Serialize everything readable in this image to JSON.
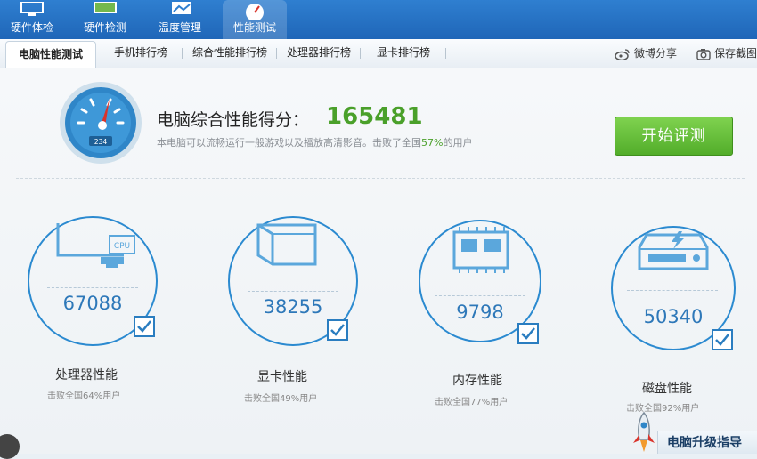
{
  "top_nav": {
    "items": [
      {
        "label": "硬件体检",
        "icon": "monitor-icon",
        "active": false
      },
      {
        "label": "硬件检测",
        "icon": "monitor-icon",
        "active": false
      },
      {
        "label": "温度管理",
        "icon": "chart-icon",
        "active": false
      },
      {
        "label": "性能测试",
        "icon": "speedometer-icon",
        "active": true
      }
    ]
  },
  "sub_tabs": {
    "items": [
      {
        "label": "电脑性能测试",
        "active": true
      },
      {
        "label": "手机排行榜",
        "active": false
      },
      {
        "label": "综合性能排行榜",
        "active": false
      },
      {
        "label": "处理器排行榜",
        "active": false
      },
      {
        "label": "显卡排行榜",
        "active": false
      }
    ],
    "weibo_share": "微博分享",
    "save_screenshot": "保存截图"
  },
  "score": {
    "title": "电脑综合性能得分：",
    "value": "165481",
    "subtitle_prefix": "本电脑可以流畅运行一般游戏以及播放高清影音。击败了全国",
    "subtitle_pct": "57%",
    "subtitle_suffix": "的用户",
    "gauge_text": "234"
  },
  "start_button": "开始评测",
  "metrics": [
    {
      "name": "处理器性能",
      "value": "67088",
      "desc": "击败全国64%用户",
      "icon": "cpu-monitor-icon"
    },
    {
      "name": "显卡性能",
      "value": "38255",
      "desc": "击败全国49%用户",
      "icon": "graphics-cube-icon"
    },
    {
      "name": "内存性能",
      "value": "9798",
      "desc": "击败全国77%用户",
      "icon": "memory-chip-icon"
    },
    {
      "name": "磁盘性能",
      "value": "50340",
      "desc": "击败全国92%用户",
      "icon": "hard-disk-icon"
    }
  ],
  "upgrade_guide": "电脑升级指导",
  "colors": {
    "nav_blue": "#1f66b8",
    "accent_green": "#4aa02a",
    "ring_blue": "#2b8ad0"
  }
}
